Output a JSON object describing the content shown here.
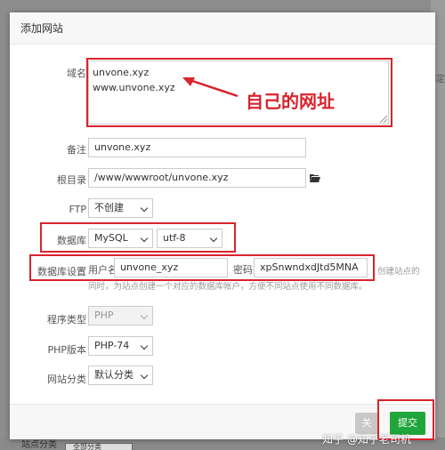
{
  "background": {
    "right_text": "绑定",
    "bottom_label": "站点分类",
    "bottom_select": "全部分类"
  },
  "modal": {
    "title": "添加网站",
    "fields": {
      "domain_label": "域名",
      "domain_lines": [
        "unvone.xyz",
        "www.unvone.xyz"
      ],
      "remark_label": "备注",
      "remark_value": "unvone.xyz",
      "root_label": "根目录",
      "root_value": "/www/wwwroot/unvone.xyz",
      "ftp_label": "FTP",
      "ftp_value": "不创建",
      "db_label": "数据库",
      "db_type": "MySQL",
      "db_charset": "utf-8",
      "db_settings_label": "数据库设置",
      "db_user_label": "用户名",
      "db_user_value": "unvone_xyz",
      "db_pass_label": "密码",
      "db_pass_value": "xpSnwndxdJtd5MNA",
      "db_hint_right": "创建站点的",
      "db_hint_below": "同时，为站点创建一个对应的数据库帐户，方便不同站点使用不同数据库。",
      "program_label": "程序类型",
      "program_value": "PHP",
      "php_label": "PHP版本",
      "php_value": "PHP-74",
      "category_label": "网站分类",
      "category_value": "默认分类"
    },
    "footer": {
      "cancel_label": "关",
      "submit_label": "提交"
    }
  },
  "annotation": {
    "text": "自己的网址",
    "color": "#d9232d"
  },
  "watermark": "知乎 @知乎老司机",
  "colors": {
    "accent_green": "#20a53a",
    "annotation_red": "#d9232d"
  }
}
